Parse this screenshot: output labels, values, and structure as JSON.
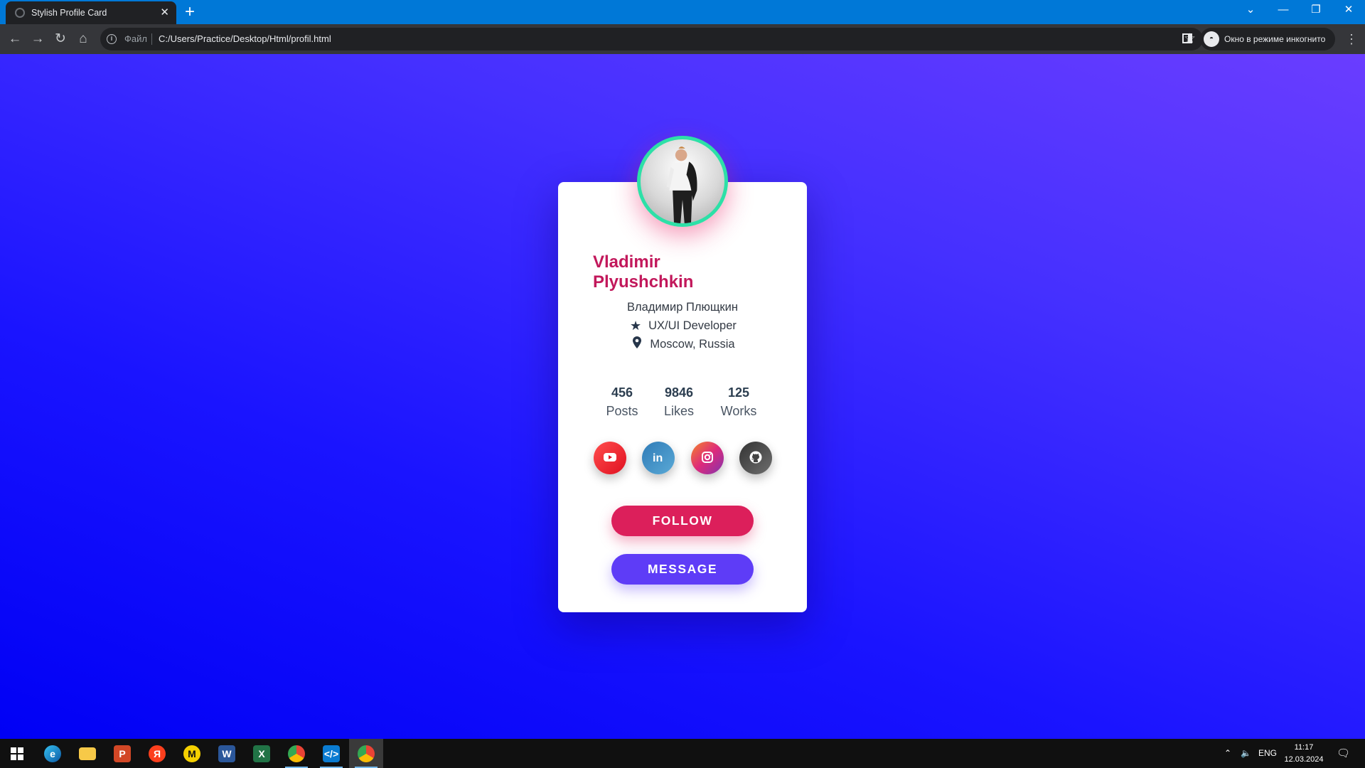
{
  "browser": {
    "tab_title": "Stylish Profile Card",
    "tab_close": "✕",
    "new_tab": "+",
    "url_scheme": "Файл",
    "url": "C:/Users/Practice/Desktop/Html/profil.html",
    "incognito_label": "Окно в режиме инкогнито"
  },
  "profile": {
    "name": "Vladimir Plyushchkin",
    "name_native": "Владимир Плющкин",
    "role": "UX/UI Developer",
    "location": "Moscow, Russia",
    "stats": [
      {
        "value": "456",
        "label": "Posts"
      },
      {
        "value": "9846",
        "label": "Likes"
      },
      {
        "value": "125",
        "label": "Works"
      }
    ],
    "socials": [
      {
        "icon": "youtube-icon",
        "color": "#f5222d"
      },
      {
        "icon": "linkedin-icon",
        "color": "#3a8fc4"
      },
      {
        "icon": "instagram-icon",
        "color": "#e1306c"
      },
      {
        "icon": "github-icon",
        "color": "#555555"
      }
    ],
    "follow_label": "FOLLOW",
    "message_label": "MESSAGE",
    "accent_color": "#c2185b",
    "avatar_ring_color": "#2de0a7"
  },
  "taskbar": {
    "apps": [
      "windows-start",
      "edge",
      "file-explorer",
      "powerpoint",
      "yandex",
      "app-yellow",
      "word",
      "excel",
      "chrome",
      "vscode",
      "chrome-active"
    ],
    "language": "ENG",
    "time": "11:17",
    "date": "12.03.2024"
  }
}
